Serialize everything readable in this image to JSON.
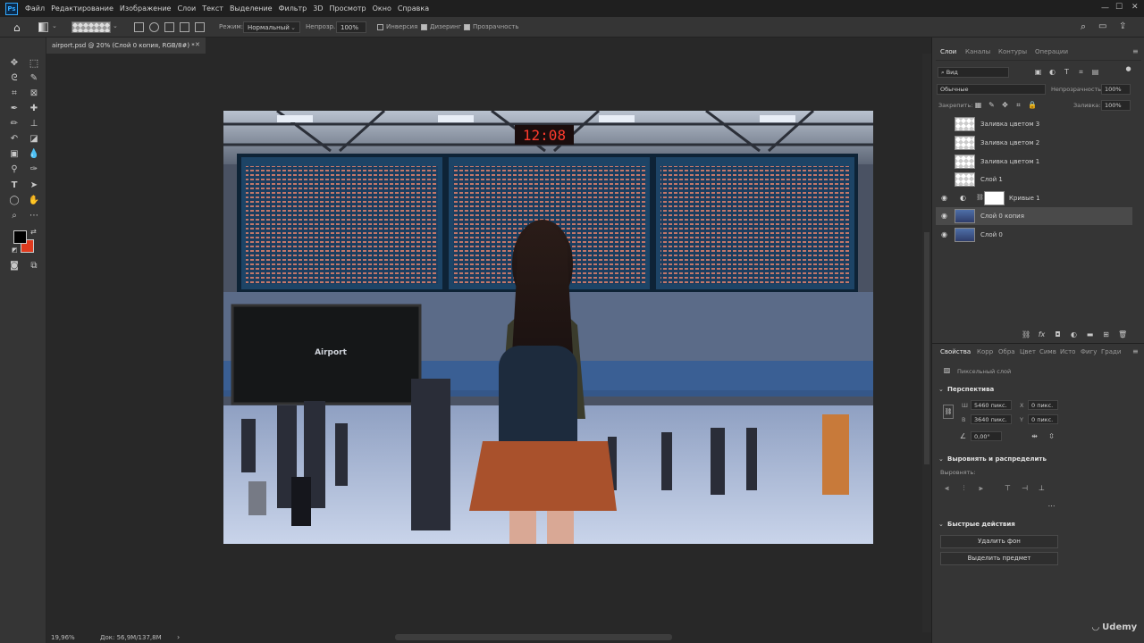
{
  "menubar": {
    "logo": "Ps",
    "items": [
      "Файл",
      "Редактирование",
      "Изображение",
      "Слои",
      "Текст",
      "Выделение",
      "Фильтр",
      "3D",
      "Просмотр",
      "Окно",
      "Справка"
    ]
  },
  "options": {
    "mode_label": "Режим:",
    "mode_value": "Нормальный",
    "opacity_label": "Непрозр.:",
    "opacity_value": "100%",
    "invert_label": "Инверсия",
    "dither_label": "Дизеринг",
    "transparency_label": "Прозрачность"
  },
  "document": {
    "tab_title": "airport.psd @ 20% (Слой 0 копия, RGB/8#) *",
    "board_clock": "12:08",
    "screen_text": "Airport"
  },
  "status": {
    "zoom": "19,96%",
    "doc_info": "Док: 56,9M/137,8M"
  },
  "layers_panel": {
    "tabs": [
      "Слои",
      "Каналы",
      "Контуры",
      "Операции"
    ],
    "filter_label": "Вид",
    "blend_mode": "Обычные",
    "opacity_label": "Непрозрачность:",
    "opacity_value": "100%",
    "lock_label": "Закрепить:",
    "fill_label": "Заливка:",
    "fill_value": "100%",
    "layers": [
      {
        "name": "Заливка цветом 3",
        "visible": false
      },
      {
        "name": "Заливка цветом 2",
        "visible": false
      },
      {
        "name": "Заливка цветом 1",
        "visible": false
      },
      {
        "name": "Слой 1",
        "visible": false
      },
      {
        "name": "Кривые 1",
        "visible": true
      },
      {
        "name": "Слой 0 копия",
        "visible": true,
        "selected": true
      },
      {
        "name": "Слой 0",
        "visible": true
      }
    ]
  },
  "properties_panel": {
    "tabs": [
      "Свойства",
      "Корр",
      "Обра",
      "Цвет",
      "Симв",
      "Исто",
      "Фигу",
      "Гради"
    ],
    "layer_type": "Пиксельный слой",
    "perspective_title": "Перспектива",
    "w_label": "Ш",
    "w_value": "5460 пикс.",
    "h_label": "В",
    "h_value": "3640 пикс.",
    "x_label": "X",
    "x_value": "0 пикс.",
    "y_label": "Y",
    "y_value": "0 пикс.",
    "angle_value": "0,00°",
    "align_title": "Выровнять и распределить",
    "align_label": "Выровнять:",
    "quick_actions_title": "Быстрые действия",
    "remove_bg": "Удалить фон",
    "select_subject": "Выделить предмет"
  },
  "watermark": "Udemy",
  "colors": {
    "foreground": "#000000",
    "background": "#e03a1e",
    "accent": "#31a8ff"
  }
}
